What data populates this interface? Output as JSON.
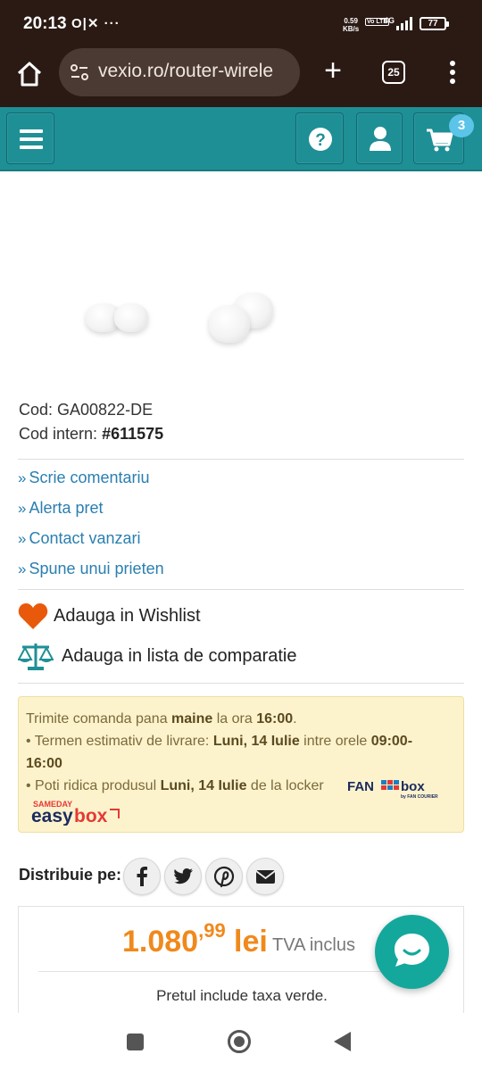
{
  "status": {
    "time": "20:13",
    "left_icons": "O|✕ ···",
    "speed_value": "0.59",
    "speed_unit": "KB/s",
    "volte": "Vo LTE",
    "network": "4G",
    "battery": "77"
  },
  "browser": {
    "url": "vexio.ro/router-wirele",
    "tab_count": "25"
  },
  "site": {
    "cart_count": "3",
    "colors": {
      "header": "#1f8f96",
      "price": "#f0891c",
      "link": "#2a7fb0",
      "chat": "#14a89d",
      "heart": "#e8590c"
    }
  },
  "product": {
    "code": "Cod: GA00822-DE",
    "code_intern_label": "Cod intern: ",
    "code_intern_value": "#611575"
  },
  "links": [
    {
      "chev": "»",
      "label": "Scrie comentariu"
    },
    {
      "chev": "»",
      "label": "Alerta pret"
    },
    {
      "chev": "»",
      "label": "Contact vanzari"
    },
    {
      "chev": "»",
      "label": "Spune unui prieten"
    }
  ],
  "actions": {
    "wishlist": "Adauga in Wishlist",
    "compare": "Adauga in lista de comparatie"
  },
  "delivery": {
    "l1_a": "Trimite comanda pana ",
    "l1_b": "maine",
    "l1_c": " la ora ",
    "l1_d": "16:00",
    "l1_e": ".",
    "l2_a": "• Termen estimativ de livrare: ",
    "l2_b": "Luni, 14 Iulie",
    "l2_c": " intre orele ",
    "l2_d": "09:00-",
    "l3": "16:00",
    "l4_a": "• Poti ridica produsul ",
    "l4_b": "Luni, 14 Iulie",
    "l4_c": " de la locker",
    "fanbox_logo": "FAN box by FAN COURIER",
    "easybox_logo": "SAMEDAY easybox"
  },
  "share": {
    "label": "Distribuie pe:",
    "networks": [
      "facebook-icon",
      "twitter-icon",
      "pinterest-icon",
      "email-icon"
    ]
  },
  "price": {
    "integer": "1.080",
    "decimals": ",99",
    "currency": "lei",
    "vat": "TVA inclus",
    "note": "Pretul include taxa verde."
  }
}
